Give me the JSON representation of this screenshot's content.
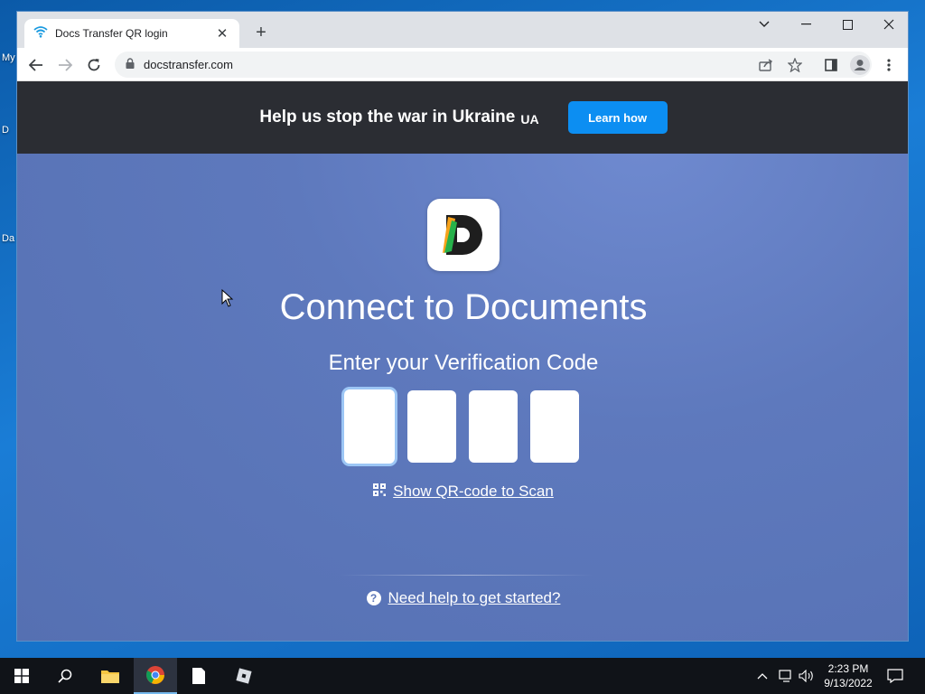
{
  "desktop": {
    "labels": [
      "My",
      "D",
      "Da"
    ]
  },
  "browser": {
    "tab_title": "Docs Transfer QR login",
    "tab_close": "✕",
    "new_tab": "+",
    "url": "docstransfer.com"
  },
  "banner": {
    "text": "Help us stop the war in Ukraine",
    "ua": "UA",
    "button_label": "Learn how"
  },
  "main": {
    "app_logo_letter": "D",
    "title": "Connect to Documents",
    "subtitle": "Enter your Verification Code",
    "code_boxes": [
      "",
      "",
      "",
      ""
    ],
    "qr_link": "Show QR-code to Scan",
    "help_link": "Need help to get started?",
    "help_icon": "?"
  },
  "taskbar": {
    "time": "2:23 PM",
    "date": "9/13/2022"
  },
  "colors": {
    "banner_bg": "#2b2d33",
    "accent_button": "#0c8ef2",
    "page_bg": "#5e79bd"
  }
}
